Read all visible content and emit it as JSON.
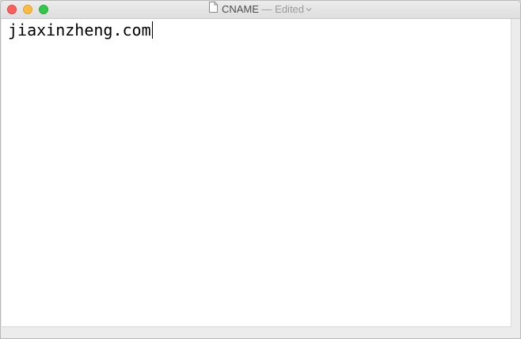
{
  "window": {
    "filename": "CNAME",
    "separator": "—",
    "status": "Edited"
  },
  "editor": {
    "content": "jiaxinzheng.com"
  },
  "colors": {
    "close": "#fc605c",
    "minimize": "#fdbc40",
    "zoom": "#34c84a"
  },
  "icons": {
    "document": "document-icon",
    "chevron": "chevron-down-icon"
  }
}
